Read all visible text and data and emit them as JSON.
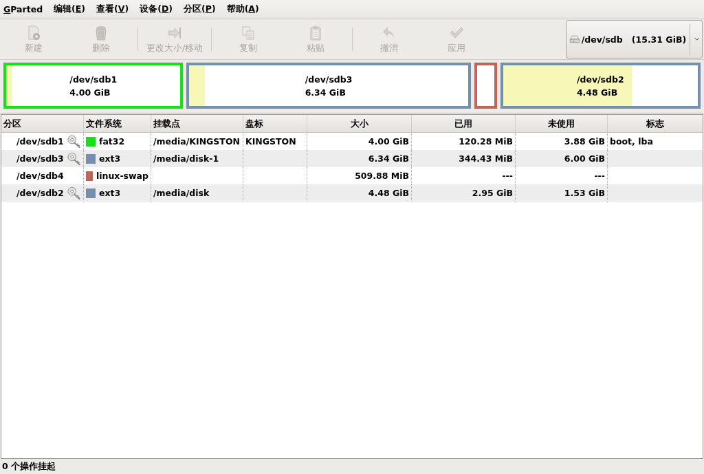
{
  "menu": [
    {
      "key": "G",
      "tail": "Parted"
    },
    {
      "lead": "编辑(",
      "key": "E",
      "tail": ")"
    },
    {
      "lead": "查看(",
      "key": "V",
      "tail": ")"
    },
    {
      "lead": "设备(",
      "key": "D",
      "tail": ")"
    },
    {
      "lead": "分区(",
      "key": "P",
      "tail": ")"
    },
    {
      "lead": "帮助(",
      "key": "A",
      "tail": ")"
    }
  ],
  "toolbar": [
    [
      {
        "kind": "new",
        "label": "新建",
        "disabled": true
      },
      {
        "kind": "delete",
        "label": "删除",
        "disabled": true
      }
    ],
    [
      {
        "kind": "resize",
        "label": "更改大小/移动",
        "disabled": true
      }
    ],
    [
      {
        "kind": "copy",
        "label": "复制",
        "disabled": true
      },
      {
        "kind": "paste",
        "label": "粘贴",
        "disabled": true
      }
    ],
    [
      {
        "kind": "undo",
        "label": "撤消",
        "disabled": true
      },
      {
        "kind": "apply",
        "label": "应用",
        "disabled": true
      }
    ]
  ],
  "device_selector": {
    "label": "/dev/sdb   (15.31 GiB)"
  },
  "partition_map": [
    {
      "name": "/dev/sdb1",
      "size": "4.00 GiB",
      "color": "#18e018",
      "level": 0.03
    },
    {
      "name": "/dev/sdb3",
      "size": "6.34 GiB",
      "color": "#7590ae",
      "level": 0.055
    },
    {
      "color": "#c0645a"
    },
    {
      "name": "/dev/sdb2",
      "size": "4.48 GiB",
      "color": "#7590ae",
      "level": 0.66
    }
  ],
  "table": {
    "columns": [
      "分区",
      "文件系统",
      "挂载点",
      "盘标",
      "大小",
      "已用",
      "未使用",
      "标志"
    ],
    "rows": [
      {
        "partition": "/dev/sdb1",
        "mounted": true,
        "filesystem": "fat32",
        "color": "#18e018",
        "mount_point": "/media/KINGSTON",
        "label": "KINGSTON",
        "size": "4.00 GiB",
        "used": "120.28 MiB",
        "unused": "3.88 GiB",
        "flags": "boot, lba"
      },
      {
        "partition": "/dev/sdb3",
        "mounted": true,
        "filesystem": "ext3",
        "color": "#7590ae",
        "mount_point": "/media/disk-1",
        "size": "6.34 GiB",
        "used": "344.43 MiB",
        "unused": "6.00 GiB"
      },
      {
        "partition": "/dev/sdb4",
        "mounted": false,
        "filesystem": "linux-swap",
        "color": "#c0645a",
        "size": "509.88 MiB",
        "used": "---",
        "unused": "---"
      },
      {
        "partition": "/dev/sdb2",
        "mounted": true,
        "filesystem": "ext3",
        "color": "#7590ae",
        "mount_point": "/media/disk",
        "size": "4.48 GiB",
        "used": "2.95 GiB",
        "unused": "1.53 GiB"
      }
    ]
  },
  "status_bar": "0 个操作挂起"
}
